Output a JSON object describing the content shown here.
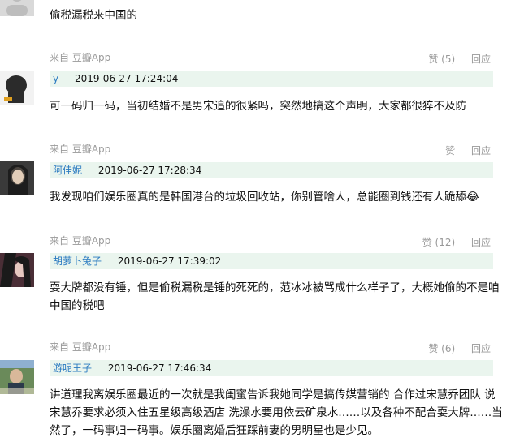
{
  "top_comment": {
    "text": "偷税漏税来中国的",
    "source": "来自 豆瓣App",
    "like": "赞 (5)",
    "reply": "回应"
  },
  "comments": [
    {
      "author": "y",
      "time": "2019-06-27 17:24:04",
      "text": "可一码归一码，当初结婚不是男宋追的很紧吗，突然地搞这个声明，大家都很猝不及防",
      "source": "来自 豆瓣App",
      "like": "赞",
      "reply": "回应"
    },
    {
      "author": "阿佳妮",
      "time": "2019-06-27 17:28:34",
      "text": "我发现咱们娱乐圈真的是韩国港台的垃圾回收站，你别管啥人，总能圈到钱还有人跪舔😂",
      "source": "来自 豆瓣App",
      "like": "赞 (12)",
      "reply": "回应"
    },
    {
      "author": "胡萝卜兔子",
      "time": "2019-06-27 17:39:02",
      "text": "耍大牌都没有锤，但是偷税漏税是锤的死死的，范冰冰被骂成什么样子了，大概她偷的不是咱中国的税吧",
      "source": "来自 豆瓣App",
      "like": "赞 (6)",
      "reply": "回应"
    },
    {
      "author": "游呢王子",
      "time": "2019-06-27 17:46:34",
      "text": "讲道理我离娱乐圈最近的一次就是我闺蜜告诉我她同学是搞传媒营销的 合作过宋慧乔团队 说宋慧乔要求必须入住五星级高级酒店 洗澡水要用依云矿泉水……以及各种不配合耍大牌……当然了，一码事归一码事。娱乐圈离婚后狂踩前妻的男明星也是少见。"
    }
  ],
  "icons": {
    "avatar_top": "avatar-gray-placeholder",
    "avatar_y": "avatar-lion-silhouette",
    "avatar_ajiani": "avatar-woman-portrait",
    "avatar_huluobo": "avatar-woman-portrait",
    "avatar_younizi": "avatar-man-portrait"
  },
  "colors": {
    "author_link": "#2a7ac0",
    "header_bg": "#eaf5ee",
    "muted_text": "#999999"
  }
}
